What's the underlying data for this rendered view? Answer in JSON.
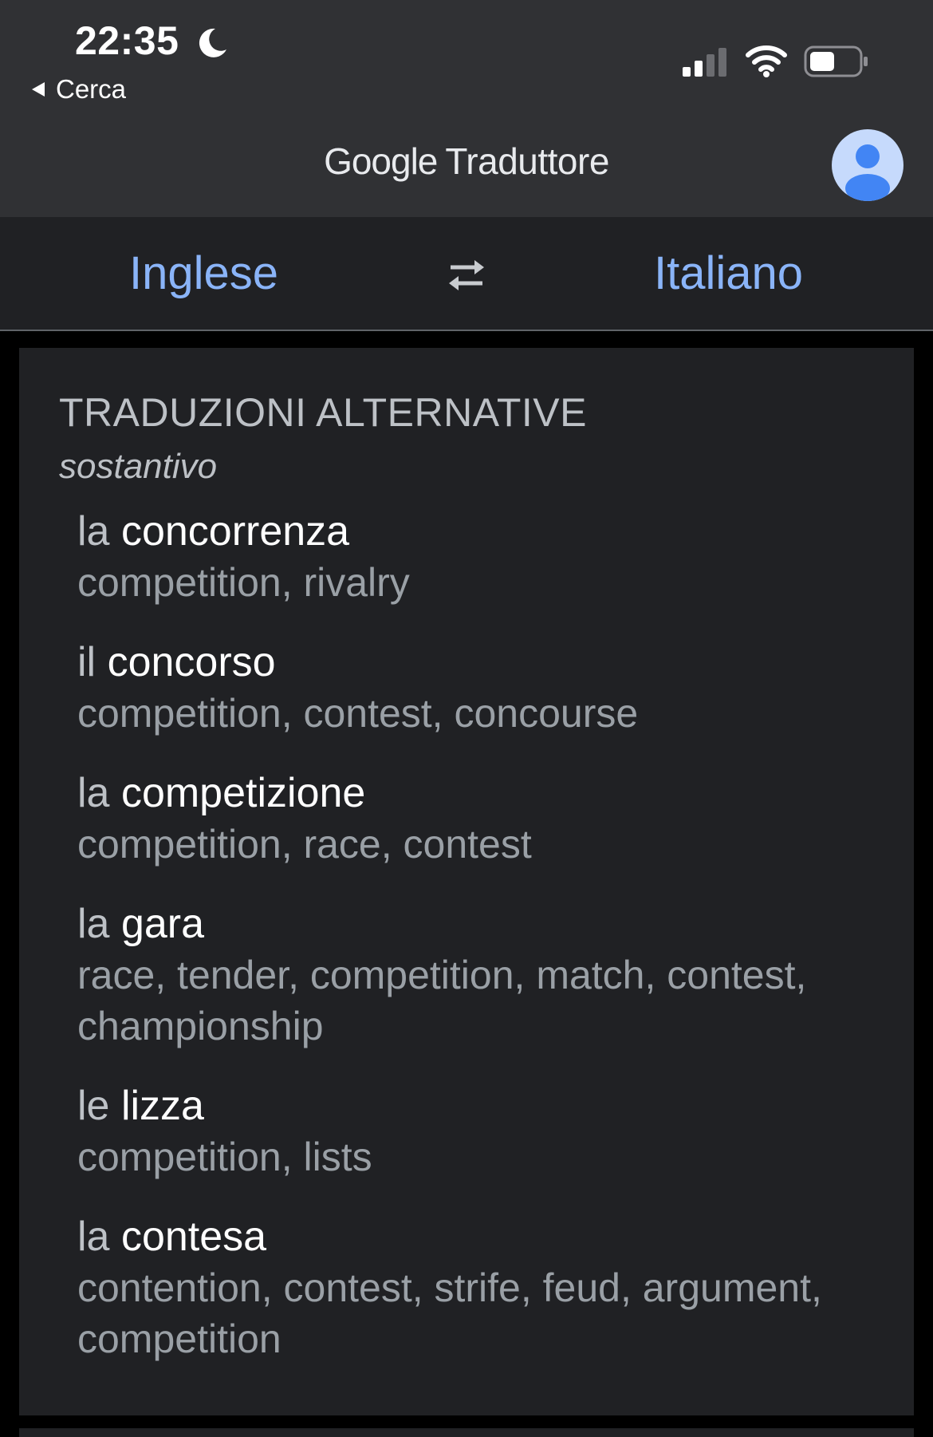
{
  "status_bar": {
    "time": "22:35",
    "back_label": "Cerca"
  },
  "app_bar": {
    "brand": "Google",
    "title": "Traduttore"
  },
  "languages": {
    "source": "Inglese",
    "target": "Italiano"
  },
  "alternatives": {
    "heading": "TRADUZIONI ALTERNATIVE",
    "part_of_speech": "sostantivo",
    "entries": [
      {
        "article": "la",
        "word": "concorrenza",
        "synonyms": "competition, rivalry"
      },
      {
        "article": "il",
        "word": "concorso",
        "synonyms": "competition, contest, concourse"
      },
      {
        "article": "la",
        "word": "competizione",
        "synonyms": "competition, race, contest"
      },
      {
        "article": "la",
        "word": "gara",
        "synonyms": "race, tender, competition, match, contest, championship"
      },
      {
        "article": "le",
        "word": "lizza",
        "synonyms": "competition, lists"
      },
      {
        "article": "la",
        "word": "contesa",
        "synonyms": "contention, contest, strife, feud, argument, competition"
      }
    ]
  },
  "colors": {
    "accent": "#8ab4f8",
    "app_bar_bg": "#303134",
    "card_bg": "#202124",
    "page_bg": "#000000"
  },
  "icons": {
    "moon": "moon-icon",
    "back": "back-arrow-icon",
    "signal": "cellular-signal-icon",
    "wifi": "wifi-icon",
    "battery": "battery-icon",
    "avatar": "account-avatar-icon",
    "swap": "swap-languages-icon"
  }
}
